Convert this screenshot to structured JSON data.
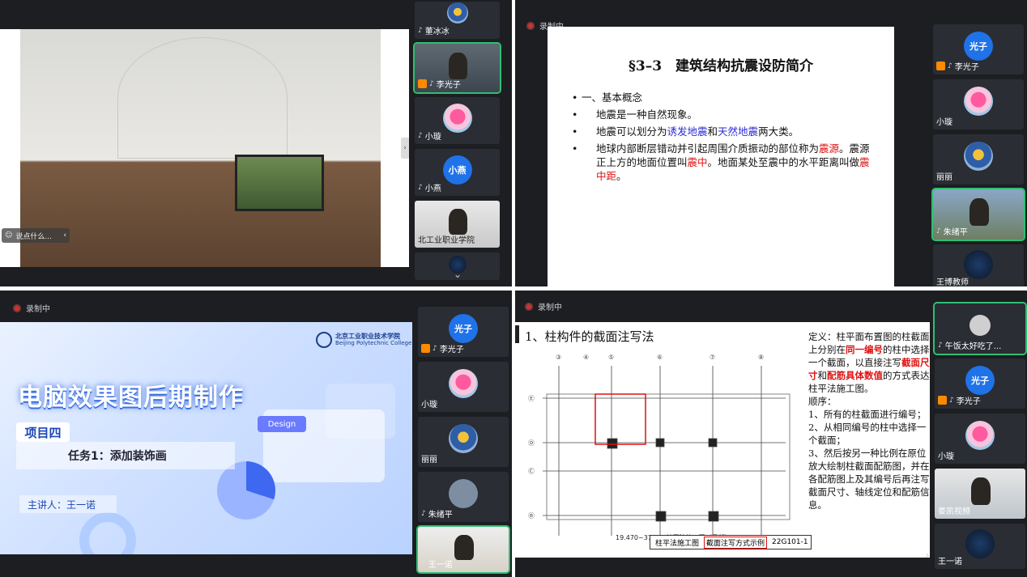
{
  "q1": {
    "caption": "说点什么...",
    "tiles": [
      {
        "name": "董冰冰",
        "kind": "bird"
      },
      {
        "name": "李光子",
        "kind": "video",
        "active": true
      },
      {
        "name": "小璇",
        "kind": "flower"
      },
      {
        "name": "小燕",
        "kind": "text",
        "avatar": "小燕"
      },
      {
        "name": "北工业职业学院",
        "kind": "video"
      }
    ]
  },
  "q2": {
    "rec_label": "录制中",
    "slide": {
      "title": "§3–3　建筑结构抗震设防简介",
      "line1": "一、基本概念",
      "line2": "地震是一种自然现象。",
      "line3_a": "地震可以划分为",
      "line3_b": "诱发地震",
      "line3_c": "和",
      "line3_d": "天然地震",
      "line3_e": "两大类。",
      "line4_a": "地球内部断层错动并引起周围介质振动的部位称为",
      "line4_b": "震源",
      "line4_c": "。震源正上方的地面位置叫",
      "line4_d": "震中",
      "line4_e": "。地面某处至震中的水平距离叫做",
      "line4_f": "震中距",
      "line4_g": "。"
    },
    "tiles": [
      {
        "name": "李光子",
        "avatar": "光子"
      },
      {
        "name": "小璇"
      },
      {
        "name": "丽丽"
      },
      {
        "name": "朱绪平"
      },
      {
        "name": "王博教师"
      }
    ]
  },
  "q3": {
    "rec_label": "录制中",
    "slide": {
      "logo": "北京工业职业技术学院",
      "logo_en": "Beijing Polytechnic College",
      "title": "电脑效果图后期制作",
      "project": "项目四",
      "task": "任务1：添加装饰画",
      "speaker": "主讲人：王一诺",
      "design": "Design"
    },
    "tiles": [
      {
        "name": "李光子",
        "avatar": "光子"
      },
      {
        "name": "小璇"
      },
      {
        "name": "丽丽"
      },
      {
        "name": "朱绪平"
      },
      {
        "name": "王一诺"
      }
    ]
  },
  "q4": {
    "rec_label": "录制中",
    "slide": {
      "heading": "1、柱构件的截面注写法",
      "def_a": "定义：柱平面布置图的柱截面上分别在",
      "def_b": "同一编号",
      "def_c": "的柱中选择一个截面，以直接注写",
      "def_d": "截面尺寸",
      "def_e": "和",
      "def_f": "配筋具体数值",
      "def_g": "的方式表达柱平法施工图。",
      "order": "顺序：",
      "step1": "1、所有的柱截面进行编号；",
      "step2": "2、从相同编号的柱中选择一个截面；",
      "step3": "3、然后按另一种比例在原位放大绘制柱截面配筋图，并在各配筋图上及其编号后再注写截面尺寸、轴线定位和配筋信息。",
      "drawing_caption": "19.470~37.470柱平法施工图（局部）",
      "footer_a": "柱平法施工图",
      "footer_b": "截面注写方式示例",
      "footer_c": "22G101-1"
    },
    "tiles": [
      {
        "name": "午饭太好吃了..."
      },
      {
        "name": "李光子",
        "avatar": "光子"
      },
      {
        "name": "小璇"
      },
      {
        "name": "娄凯视频"
      },
      {
        "name": "王一诺"
      }
    ]
  }
}
